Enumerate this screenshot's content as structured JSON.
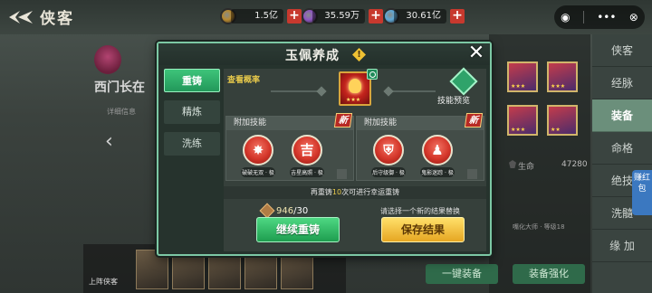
{
  "header": {
    "back_title": "侠客",
    "resources": [
      {
        "value": "1.5亿",
        "color": "#b8892f"
      },
      {
        "value": "35.59万",
        "color": "#8f56c3"
      },
      {
        "value": "30.61亿",
        "color": "#5fa9d8"
      }
    ],
    "pill": {
      "more": "•••",
      "close": "⊗"
    }
  },
  "hero": {
    "name": "西门长在",
    "sub": "详细信息"
  },
  "right_tabs": [
    "侠客",
    "经脉",
    "装备",
    "命格",
    "绝技",
    "洗髓",
    "缘 加"
  ],
  "right_tabs_active": 2,
  "right_side": {
    "stat_label": "生命",
    "stat_value": "47280",
    "info": "嘴化大师 · 等级18",
    "btn_one_click": "一键装备",
    "btn_enhance": "装备强化",
    "red_packet": "赚红包"
  },
  "bottom": {
    "label": "上阵侠客"
  },
  "dialog": {
    "title": "玉佩养成",
    "info_icon": "!",
    "close_icon": "✕",
    "tabs": [
      "重铸",
      "精炼",
      "洗练"
    ],
    "active_tab": 0,
    "view_prob": "查看概率",
    "skill_preview": "技能预览",
    "jade_stars": "★★★",
    "left_box": {
      "title": "附加技能",
      "new_badge": "新",
      "skills": [
        {
          "glyph": "✸",
          "name": "破破无双 · 极"
        },
        {
          "glyph": "吉",
          "name": "吉星高照 · 极"
        }
      ]
    },
    "right_box": {
      "title": "附加技能",
      "new_badge": "新",
      "skills": [
        {
          "glyph": "⛨",
          "name": "后守级御 · 极"
        },
        {
          "glyph": "♟",
          "name": "鬼影迷踪 · 极"
        }
      ]
    },
    "hint_pre": "再重铸",
    "hint_num": "10",
    "hint_post": "次可进行幸运重铸",
    "cost_have": "946",
    "cost_need": "/30",
    "pick_hint": "请选择一个新的结果替换",
    "btn_continue": "继续重铸",
    "btn_save": "保存结果"
  }
}
